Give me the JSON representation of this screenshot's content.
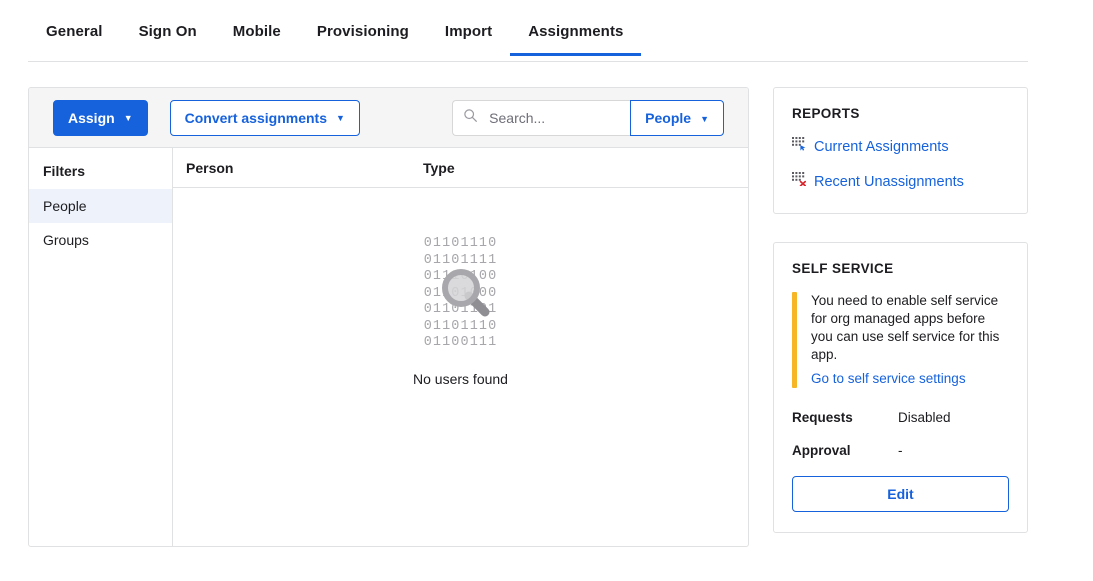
{
  "tabs": [
    {
      "label": "General",
      "active": false
    },
    {
      "label": "Sign On",
      "active": false
    },
    {
      "label": "Mobile",
      "active": false
    },
    {
      "label": "Provisioning",
      "active": false
    },
    {
      "label": "Import",
      "active": false
    },
    {
      "label": "Assignments",
      "active": true
    }
  ],
  "toolbar": {
    "assign_label": "Assign",
    "assign_caret": "▼",
    "convert_label": "Convert assignments",
    "convert_caret": "▼",
    "search_placeholder": "Search...",
    "search_value": "",
    "search_icon": "search-icon",
    "people_label": "People",
    "people_caret": "▼"
  },
  "filters": {
    "title": "Filters",
    "items": [
      {
        "label": "People",
        "selected": true
      },
      {
        "label": "Groups",
        "selected": false
      }
    ]
  },
  "table": {
    "columns": [
      "Person",
      "Type"
    ],
    "rows": [],
    "empty_state": {
      "binary_lines": [
        "01101110",
        "01101111",
        "01110100",
        "01101000",
        "01101101",
        "01101110",
        "01100111"
      ],
      "icon": "magnifying-glass-icon",
      "message": "No users found"
    }
  },
  "reports": {
    "title": "REPORTS",
    "links": [
      {
        "label": "Current Assignments",
        "icon": "grid-arrow-icon"
      },
      {
        "label": "Recent Unassignments",
        "icon": "grid-x-icon"
      }
    ]
  },
  "self_service": {
    "title": "SELF SERVICE",
    "alert_text": "You need to enable self service for org managed apps before you can use self service for this app.",
    "alert_link": "Go to self service settings",
    "fields": [
      {
        "key": "Requests",
        "value": "Disabled"
      },
      {
        "key": "Approval",
        "value": "-"
      }
    ],
    "edit_label": "Edit"
  },
  "colors": {
    "accent_blue": "#1662dc",
    "alert_yellow": "#f6b625",
    "border_gray": "#dfe1e2",
    "toolbar_gray": "#f5f5f6",
    "selected_row": "#eef3fb"
  }
}
